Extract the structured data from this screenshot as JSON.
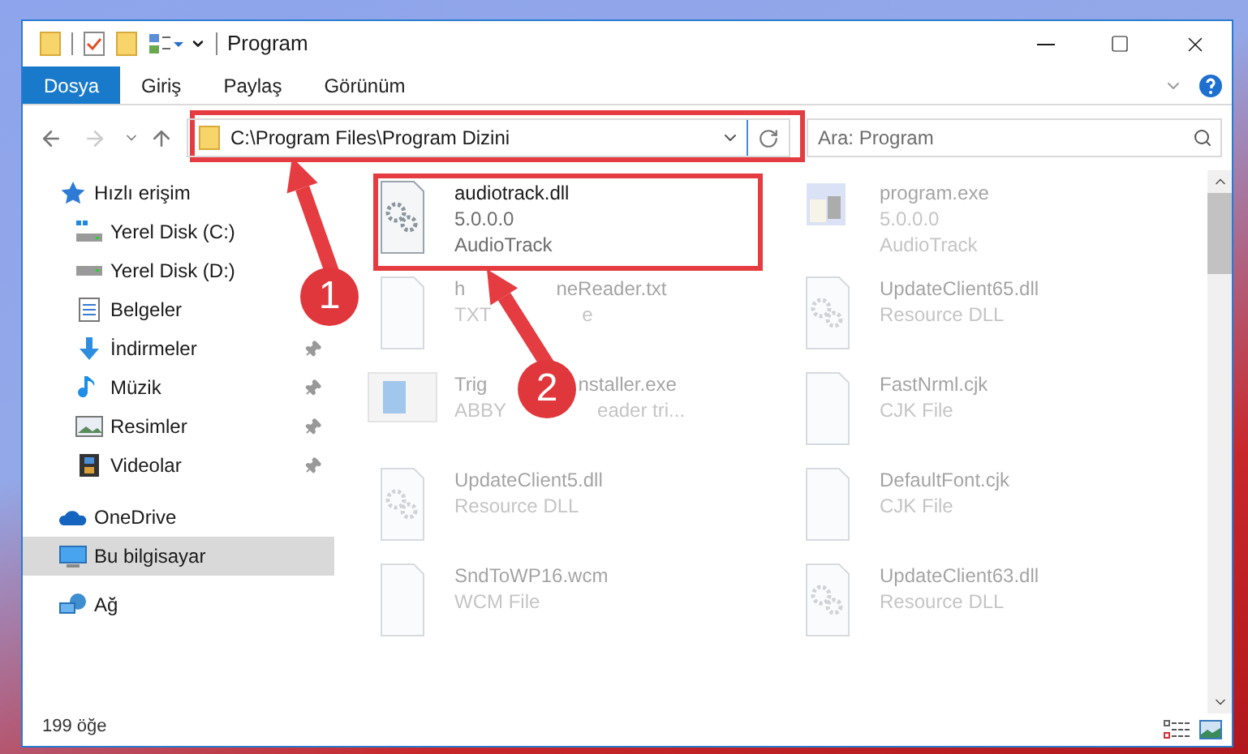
{
  "window": {
    "title": "Program"
  },
  "ribbon_tabs": [
    {
      "label": "Dosya",
      "selected": true
    },
    {
      "label": "Giriş",
      "selected": false
    },
    {
      "label": "Paylaş",
      "selected": false
    },
    {
      "label": "Görünüm",
      "selected": false
    }
  ],
  "address": {
    "value": "C:\\Program Files\\Program Dizini"
  },
  "search": {
    "placeholder": "Ara: Program"
  },
  "sidebar": {
    "items": [
      {
        "label": "Hızlı erişim",
        "kind": "quick",
        "selected": false,
        "pinned": false
      },
      {
        "label": "Yerel Disk (C:)",
        "kind": "sysdisk",
        "selected": false,
        "pinned": false
      },
      {
        "label": "Yerel Disk (D:)",
        "kind": "disk",
        "selected": false,
        "pinned": false
      },
      {
        "label": "Belgeler",
        "kind": "docs",
        "selected": false,
        "pinned": false
      },
      {
        "label": "İndirmeler",
        "kind": "download",
        "selected": false,
        "pinned": true
      },
      {
        "label": "Müzik",
        "kind": "music",
        "selected": false,
        "pinned": true
      },
      {
        "label": "Resimler",
        "kind": "pictures",
        "selected": false,
        "pinned": true
      },
      {
        "label": "Videolar",
        "kind": "videos",
        "selected": false,
        "pinned": true
      },
      {
        "label": "OneDrive",
        "kind": "cloud",
        "selected": false,
        "pinned": false
      },
      {
        "label": "Bu bilgisayar",
        "kind": "pc",
        "selected": true,
        "pinned": false
      },
      {
        "label": "Ağ",
        "kind": "network",
        "selected": false,
        "pinned": false
      }
    ]
  },
  "files": [
    {
      "name": [
        "audiotrack.dll"
      ],
      "lines": [
        [
          "5.0.0.0"
        ],
        [
          "AudioTrack"
        ]
      ],
      "kind": "dll",
      "blurred": false
    },
    {
      "name": [
        "program.exe"
      ],
      "lines": [
        [
          "5.0.0.0"
        ],
        [
          "AudioTrack"
        ]
      ],
      "kind": "exe",
      "blurred": true
    },
    {
      "name": [
        "h",
        "neReader.txt"
      ],
      "lines": [
        [
          "TXT",
          "e"
        ]
      ],
      "kind": "blank",
      "blurred": true
    },
    {
      "name": [
        "UpdateClient65.dll"
      ],
      "lines": [
        [
          "Resource DLL"
        ]
      ],
      "kind": "gears",
      "blurred": true
    },
    {
      "name": [
        "Trig",
        "nstaller.exe"
      ],
      "lines": [
        [
          "ABBY",
          "eader tri..."
        ]
      ],
      "kind": "app",
      "blurred": true
    },
    {
      "name": [
        "FastNrml.cjk"
      ],
      "lines": [
        [
          "CJK File"
        ]
      ],
      "kind": "blank",
      "blurred": true
    },
    {
      "name": [
        "UpdateClient5.dll"
      ],
      "lines": [
        [
          "Resource DLL"
        ]
      ],
      "kind": "gears",
      "blurred": true
    },
    {
      "name": [
        "DefaultFont.cjk"
      ],
      "lines": [
        [
          "CJK File"
        ]
      ],
      "kind": "blank",
      "blurred": true
    },
    {
      "name": [
        "SndToWP16.wcm"
      ],
      "lines": [
        [
          "WCM File"
        ]
      ],
      "kind": "blank",
      "blurred": true
    },
    {
      "name": [
        "UpdateClient63.dll"
      ],
      "lines": [
        [
          "Resource DLL"
        ]
      ],
      "kind": "gears",
      "blurred": true
    }
  ],
  "status_bar": {
    "count": "199 öğe"
  },
  "annotations": [
    {
      "number": "1"
    },
    {
      "number": "2"
    }
  ]
}
